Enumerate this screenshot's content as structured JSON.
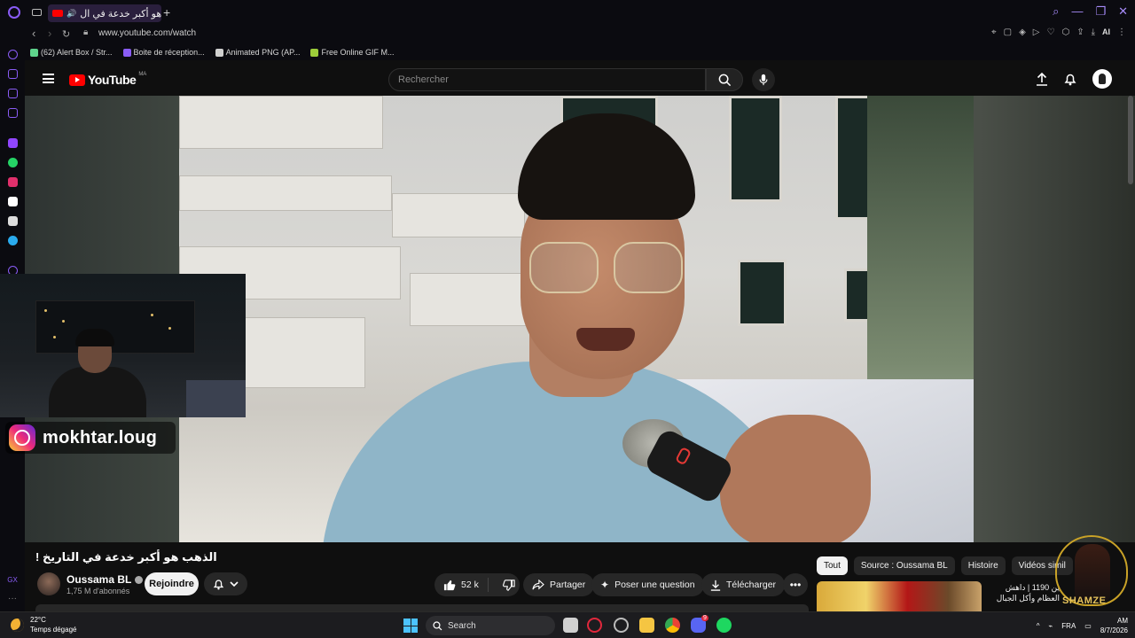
{
  "browser": {
    "tab_title": "الذهب هو أكبر خدعة في ال",
    "url": "www.youtube.com/watch",
    "bookmarks": [
      {
        "label": "(62) Alert Box / Str...",
        "color": "#5fd38d"
      },
      {
        "label": "Boite de réception...",
        "color": "#8a5cf6"
      },
      {
        "label": "Animated PNG (AP...",
        "color": "#d0d0d0"
      },
      {
        "label": "Free Online GIF M...",
        "color": "#9ccc3a"
      }
    ],
    "address_ai_label": "AI",
    "sidebar_label": "GX",
    "accent_color": "#8a5cf6"
  },
  "youtube": {
    "logo_text": "YouTube",
    "country_code": "MA",
    "search_placeholder": "Rechercher",
    "video_title": "الذهب هو أكبر خدعة في التاريخ !",
    "channel_name": "Oussama BL",
    "subscribers": "1,75 M d'abonnés",
    "join_label": "Rejoindre",
    "like_count": "52 k",
    "share_label": "Partager",
    "ask_label": "Poser une question",
    "download_label": "Télécharger",
    "chips": [
      "Tout",
      "Source : Oussama BL",
      "Histoire",
      "Vidéos simil"
    ],
    "recommendation_title": "ين 1190 | داهش العظام وأكل الجبال",
    "brand_color": "#ff0000"
  },
  "overlay": {
    "instagram_handle": "mokhtar.loug",
    "avatar_name": "SHAMZE"
  },
  "taskbar": {
    "temperature": "22°C",
    "weather": "Temps dégagé",
    "search_label": "Search",
    "language": "FRA",
    "time": "AM",
    "date": "8/7/2026",
    "badge_count": "9"
  }
}
